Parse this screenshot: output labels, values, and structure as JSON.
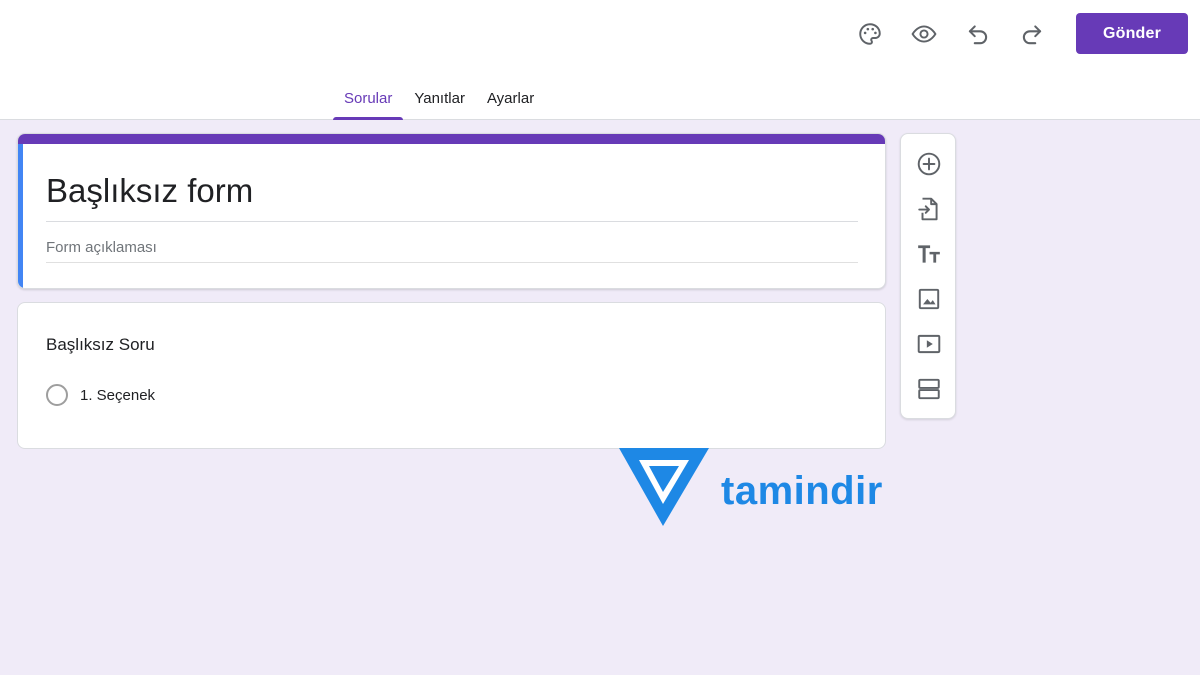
{
  "toolbar": {
    "icons": [
      "palette-icon",
      "eye-icon",
      "undo-icon",
      "redo-icon"
    ],
    "send_label": "Gönder"
  },
  "tabs": [
    {
      "label": "Sorular",
      "active": true
    },
    {
      "label": "Yanıtlar",
      "active": false
    },
    {
      "label": "Ayarlar",
      "active": false
    }
  ],
  "form": {
    "title": "Başlıksız form",
    "description_placeholder": "Form açıklaması"
  },
  "question": {
    "title": "Başlıksız Soru",
    "option_label": "1. Seçenek"
  },
  "side_toolbar": {
    "icons": [
      "add-circle-icon",
      "import-icon",
      "title-text-icon",
      "image-icon",
      "video-icon",
      "section-icon"
    ]
  },
  "watermark": {
    "text": "tamindir"
  },
  "colors": {
    "accent": "#673ab7",
    "background": "#f0ebf8",
    "title_card_left_bar": "#4285f4",
    "watermark": "#1e88e5"
  }
}
